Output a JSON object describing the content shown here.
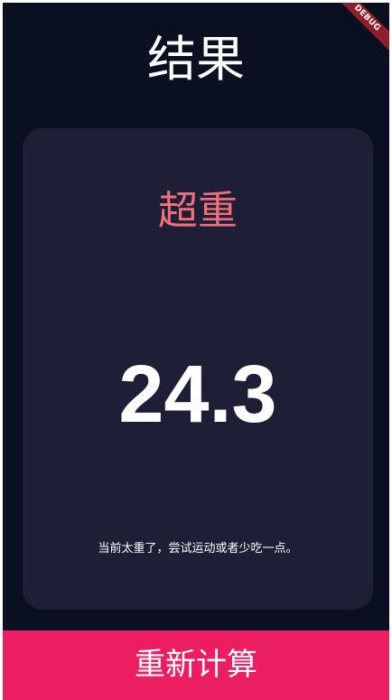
{
  "page": {
    "title": "结果",
    "debug_banner": "DEBUG"
  },
  "result": {
    "status": "超重",
    "bmi": "24.3",
    "advice": "当前太重了，尝试运动或者少吃一点。"
  },
  "actions": {
    "recalculate_label": "重新计算"
  },
  "colors": {
    "background": "#0b0f22",
    "card": "#1e1f36",
    "status_text": "#f0707a",
    "button": "#eb1e62"
  }
}
